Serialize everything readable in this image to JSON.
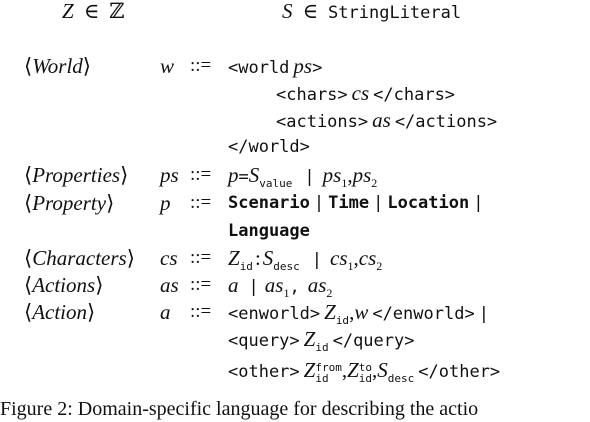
{
  "top": {
    "z_var": "Z",
    "in": "∈",
    "integers": "ℤ",
    "s_var": "S",
    "string_literal": "StringLiteral"
  },
  "ops": {
    "derives": "::=",
    "bar": "|",
    "comma": ",",
    "colon": ":",
    "eq": "="
  },
  "world": {
    "nonterminal": "World",
    "var": "w",
    "open_tag": "<world",
    "ps": "ps",
    "gt": ">",
    "chars_open": "<chars>",
    "cs": "cs",
    "chars_close": "</chars>",
    "actions_open": "<actions>",
    "as": "as",
    "actions_close": "</actions>",
    "close_tag": "</world>"
  },
  "properties": {
    "nonterminal": "Properties",
    "var": "ps",
    "p": "p",
    "S": "S",
    "value_sub": "value",
    "ps1": "ps",
    "ps2": "ps",
    "sub1": "1",
    "sub2": "2"
  },
  "property": {
    "nonterminal": "Property",
    "var": "p",
    "scenario": "Scenario",
    "time": "Time",
    "location": "Location",
    "language": "Language"
  },
  "characters": {
    "nonterminal": "Characters",
    "var": "cs",
    "Z": "Z",
    "id_sub": "id",
    "S": "S",
    "desc_sub": "desc",
    "cs1": "cs",
    "cs2": "cs",
    "sub1": "1",
    "sub2": "2"
  },
  "actions": {
    "nonterminal": "Actions",
    "var": "as",
    "a": "a",
    "as1": "as",
    "as2": "as",
    "sub1": "1",
    "sub2": "2"
  },
  "action": {
    "nonterminal": "Action",
    "var": "a",
    "enworld_open": "<enworld>",
    "Z": "Z",
    "id_sub": "id",
    "w": "w",
    "enworld_close": "</enworld>",
    "query_open": "<query>",
    "query_close": "</query>",
    "other_open": "<other>",
    "from_sup": "from",
    "to_sup": "to",
    "S": "S",
    "desc_sub": "desc",
    "other_close": "</other>"
  },
  "caption": "Figure 2: Domain-specific language for describing the actio"
}
